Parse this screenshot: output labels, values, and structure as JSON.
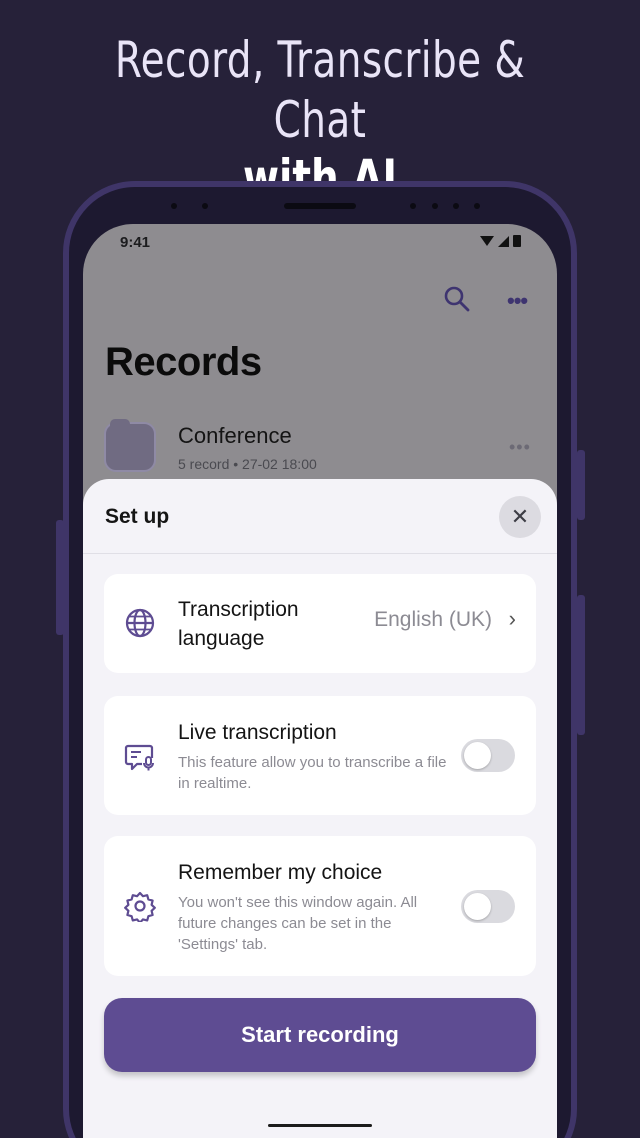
{
  "headline": {
    "line1": "Record, Transcribe & Chat",
    "line2": "with AI"
  },
  "status": {
    "time": "9:41"
  },
  "records": {
    "title": "Records",
    "folder": {
      "name": "Conference",
      "meta": "5 record • 27-02 18:00"
    }
  },
  "setup": {
    "title": "Set up",
    "language": {
      "label_line1": "Transcription",
      "label_line2": "language",
      "value": "English (UK)"
    },
    "live": {
      "title": "Live transcription",
      "desc": "This feature allow you to transcribe a file in realtime."
    },
    "remember": {
      "title": "Remember my choice",
      "desc": "You won't see this window again. All future changes can be set in the 'Settings' tab."
    },
    "start_label": "Start recording"
  },
  "accent_color": "#5e4c92",
  "background_color": "#262139"
}
